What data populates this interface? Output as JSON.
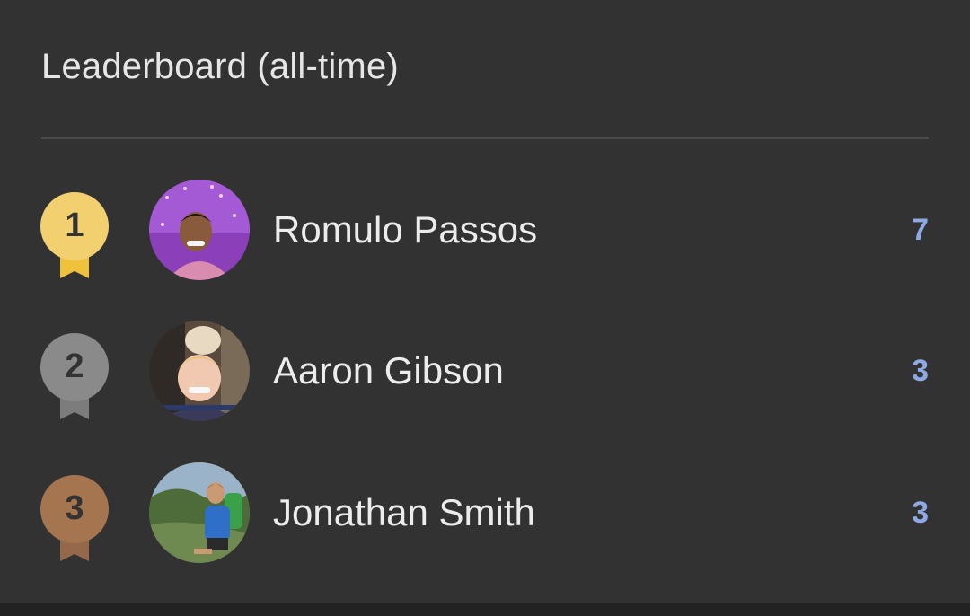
{
  "leaderboard": {
    "title": "Leaderboard (all-time)",
    "entries": [
      {
        "rank": "1",
        "name": "Romulo Passos",
        "score": "7",
        "medal_color": "#f2cf6f",
        "ribbon_color": "#f0c23c",
        "number_color": "#333333"
      },
      {
        "rank": "2",
        "name": "Aaron Gibson",
        "score": "3",
        "medal_color": "#8a8a8a",
        "ribbon_color": "#7c7c7c",
        "number_color": "#333333"
      },
      {
        "rank": "3",
        "name": "Jonathan Smith",
        "score": "3",
        "medal_color": "#a57550",
        "ribbon_color": "#96684a",
        "number_color": "#333333"
      }
    ]
  },
  "colors": {
    "background": "#323232",
    "text": "#ececec",
    "score": "#8ea9e3"
  }
}
